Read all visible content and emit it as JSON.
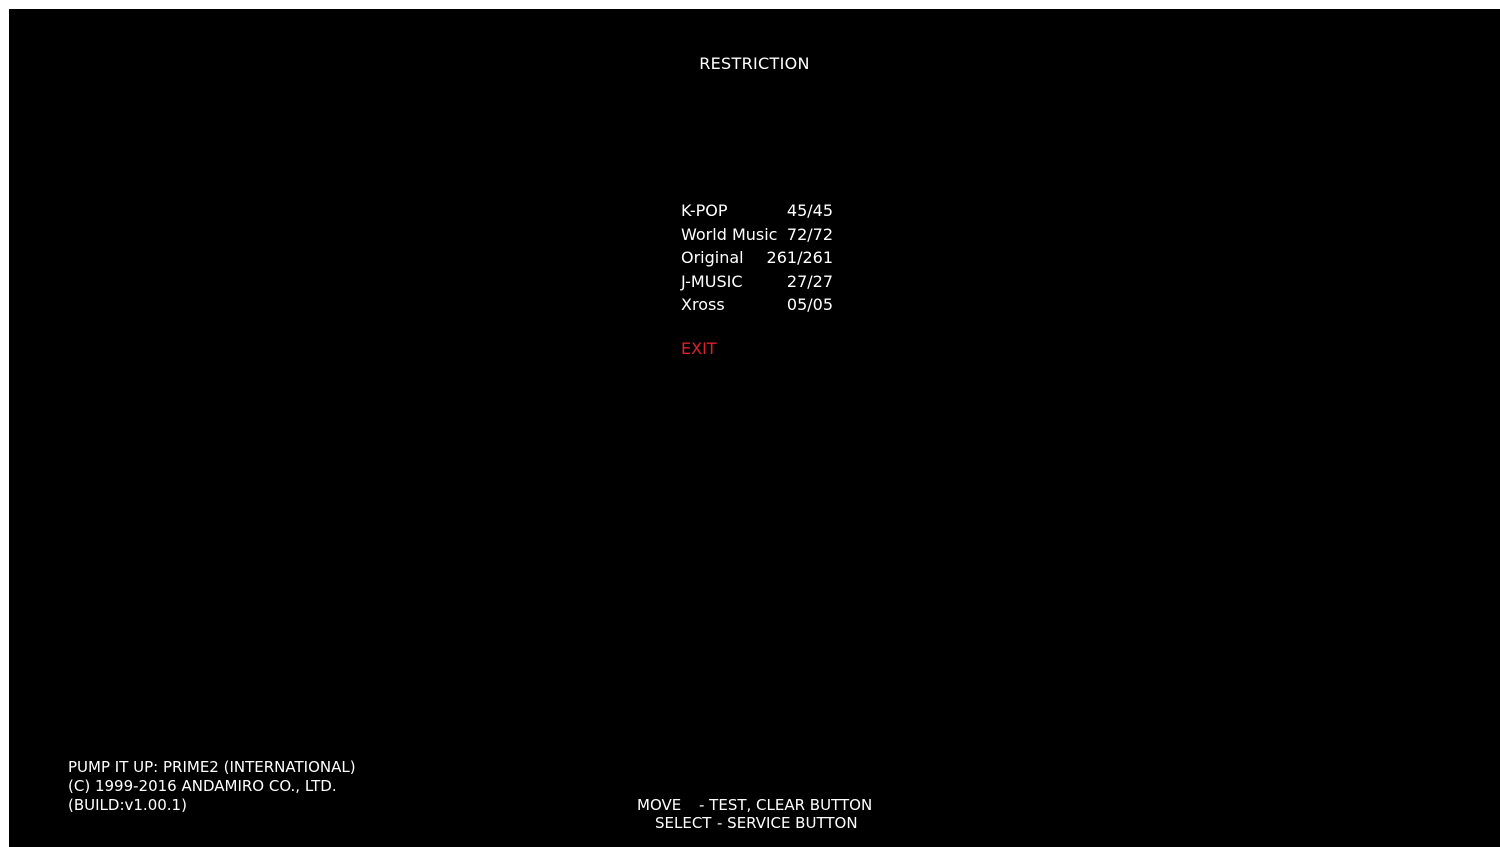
{
  "screen": {
    "title": "RESTRICTION"
  },
  "menu": {
    "items": [
      {
        "label": "K-POP",
        "count": "45/45"
      },
      {
        "label": "World Music",
        "count": "72/72"
      },
      {
        "label": "Original",
        "count": "261/261"
      },
      {
        "label": "J-MUSIC",
        "count": "27/27"
      },
      {
        "label": "Xross",
        "count": "05/05"
      }
    ],
    "exit_label": "EXIT"
  },
  "footer": {
    "game_title": "PUMP IT UP: PRIME2 (INTERNATIONAL)",
    "copyright": "(C) 1999-2016 ANDAMIRO CO., LTD.",
    "build": "(BUILD:v1.00.1)",
    "controls": [
      {
        "key": "MOVE",
        "action": "- TEST, CLEAR BUTTON"
      },
      {
        "key": "SELECT",
        "action": "- SERVICE BUTTON"
      }
    ]
  },
  "colors": {
    "background": "#000000",
    "text": "#ffffff",
    "highlight": "#e0202a"
  }
}
